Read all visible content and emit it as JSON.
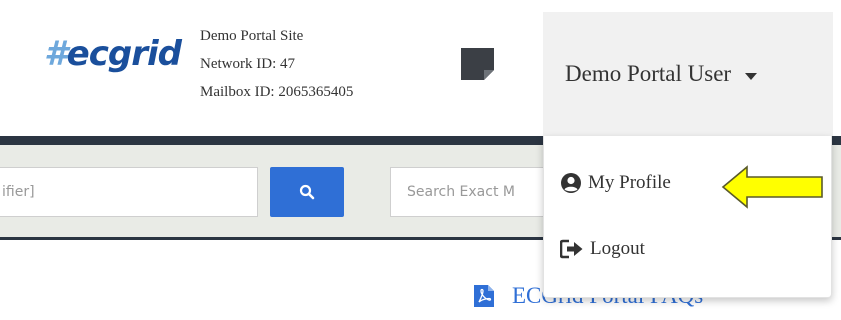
{
  "header": {
    "logo_hash": "#",
    "logo_text": "ecgrid",
    "site_name": "Demo Portal Site",
    "network_id": "Network ID: 47",
    "mailbox_id": "Mailbox ID: 2065365405",
    "user_name": "Demo Portal User"
  },
  "search": {
    "input1_value": "ifier]",
    "input2_placeholder": "Search Exact M"
  },
  "user_menu": {
    "items": [
      {
        "label": "My Profile",
        "icon": "user-circle-icon"
      },
      {
        "label": "Logout",
        "icon": "sign-out-icon"
      }
    ]
  },
  "content": {
    "faq_link": "ECGrid Portal FAQs"
  },
  "colors": {
    "brand": "#1a4f9c",
    "accent": "#2f6fd6",
    "dark_bar": "#2b3542",
    "highlight_arrow": "#ffff00"
  }
}
